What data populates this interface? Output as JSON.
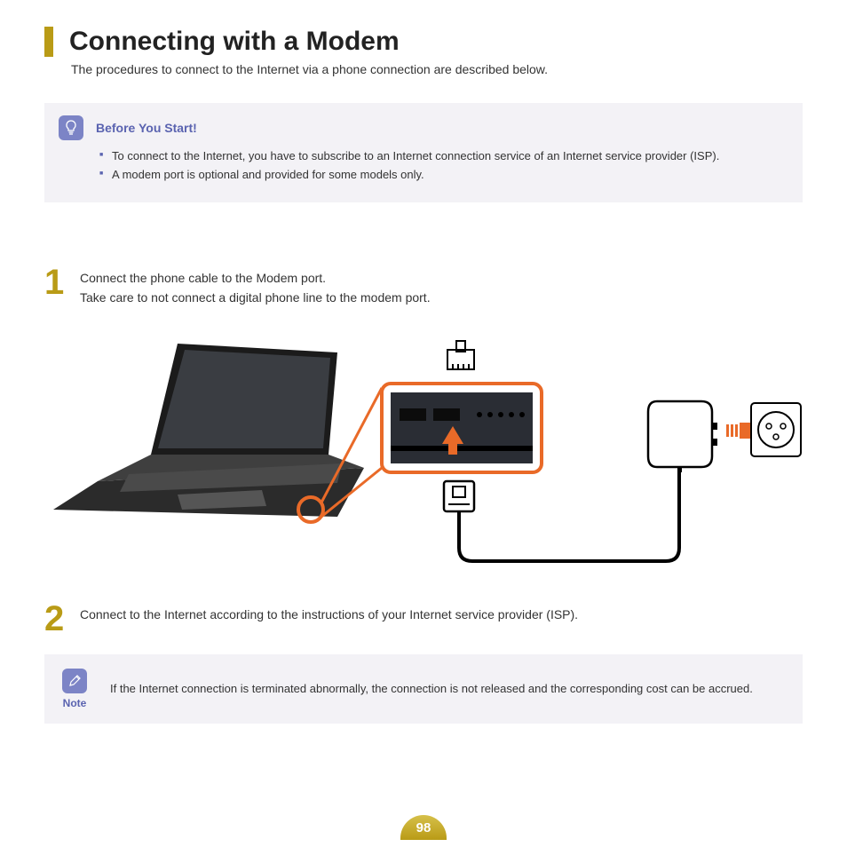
{
  "title": "Connecting with a Modem",
  "subtitle": "The procedures to connect to the Internet via a phone connection are described below.",
  "before_start": {
    "heading": "Before You Start!",
    "items": [
      "To connect to the Internet, you have to subscribe to an Internet connection service of an Internet service provider (ISP).",
      "A modem port is optional and provided for some models only."
    ]
  },
  "steps": [
    {
      "num": "1",
      "line1": "Connect the phone cable to the Modem port.",
      "line2": "Take care to not connect a digital phone line to the modem port."
    },
    {
      "num": "2",
      "line1": "Connect to the Internet according to the instructions of your Internet service provider (ISP).",
      "line2": ""
    }
  ],
  "note": {
    "label": "Note",
    "text": "If the Internet connection is terminated abnormally, the connection is not released and the corresponding cost can be accrued."
  },
  "page_num": "98"
}
